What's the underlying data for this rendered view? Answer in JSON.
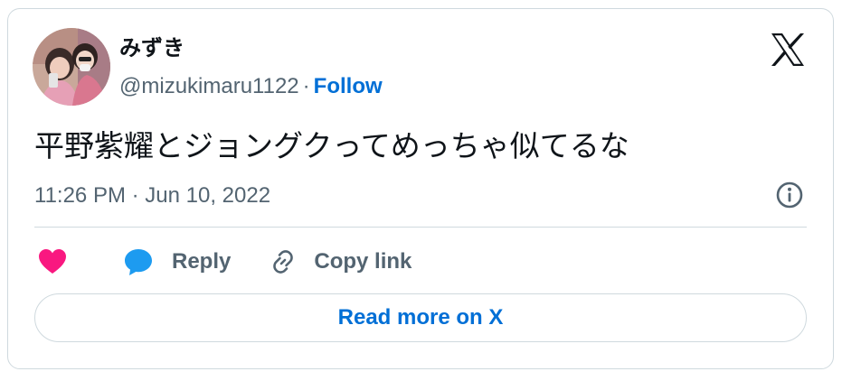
{
  "user": {
    "display_name": "みずき",
    "handle": "@mizukimaru1122",
    "separator": "·",
    "follow_label": "Follow"
  },
  "brand_icon": "x-logo-icon",
  "tweet": {
    "text": "平野紫耀とジョングクってめっちゃ似てるな",
    "timestamp": "11:26 PM · Jun 10, 2022"
  },
  "actions": {
    "like_icon": "heart-icon",
    "reply_label": "Reply",
    "reply_icon": "speech-bubble-icon",
    "copy_label": "Copy link",
    "copy_icon": "link-icon"
  },
  "info_icon": "info-circle-icon",
  "read_more_label": "Read more on X",
  "colors": {
    "text_primary": "#0f1419",
    "text_secondary": "#536471",
    "link_blue": "#006fd6",
    "heart_pink": "#f91880",
    "reply_blue": "#1d9bf0",
    "border": "#cfd9de"
  }
}
